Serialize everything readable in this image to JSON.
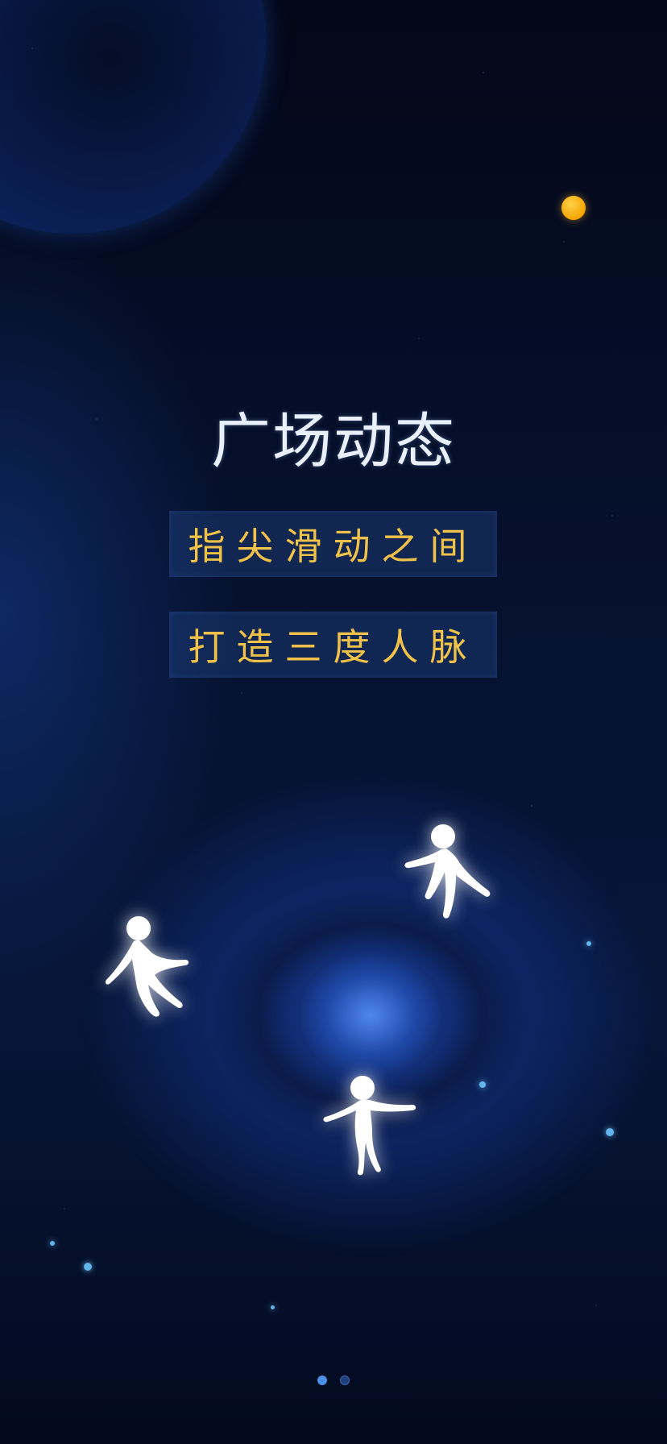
{
  "onboarding": {
    "title": "广场动态",
    "slogans": [
      "指尖滑动之间",
      "打造三度人脉"
    ]
  },
  "pager": {
    "total": 2,
    "current": 1
  },
  "colors": {
    "title": "#e9f0fb",
    "slogan": "#f0c24a",
    "dot_active": "#4c8fe8",
    "dot_inactive": "#1e3f7a",
    "sun": "#f4a400"
  },
  "icons": {
    "planet": "planet-icon",
    "sun": "sun-icon",
    "figures": [
      "person-icon",
      "person-icon",
      "person-icon"
    ]
  }
}
